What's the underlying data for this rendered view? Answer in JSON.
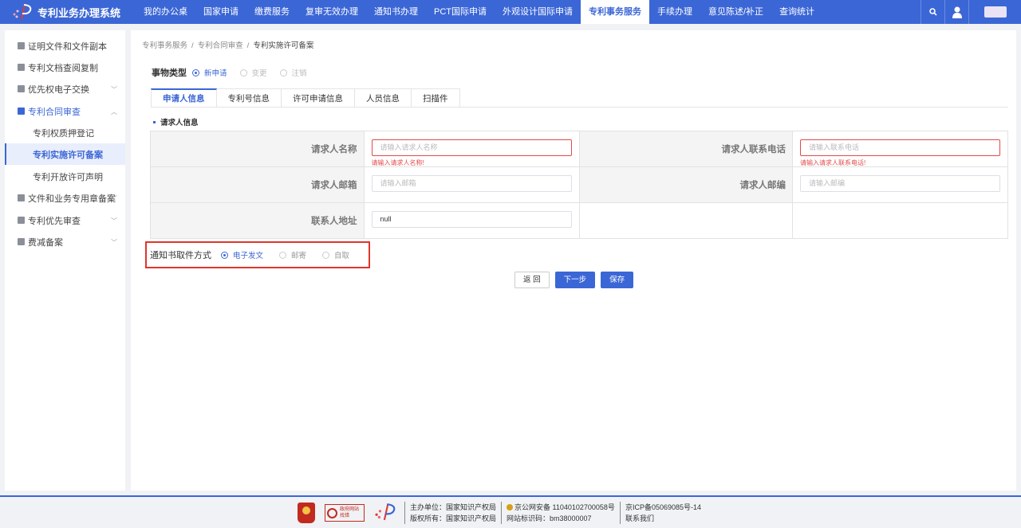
{
  "app": {
    "title": "专利业务办理系统"
  },
  "nav": {
    "items": [
      "我的办公桌",
      "国家申请",
      "缴费服务",
      "复审无效办理",
      "通知书办理",
      "PCT国际申请",
      "外观设计国际申请",
      "专利事务服务",
      "手续办理",
      "意见陈述/补正",
      "查询统计"
    ],
    "active_index": 7
  },
  "sidebar": {
    "items": [
      {
        "label": "证明文件和文件副本",
        "icon": "document-icon"
      },
      {
        "label": "专利文档查阅复制",
        "icon": "file-copy-icon"
      },
      {
        "label": "优先权电子交换",
        "icon": "exchange-icon",
        "chevron": "﹀"
      },
      {
        "label": "专利合同审查",
        "icon": "contract-icon",
        "chevron": "︿"
      },
      {
        "label": "专利权质押登记",
        "sub": true
      },
      {
        "label": "专利实施许可备案",
        "sub": true,
        "active": true
      },
      {
        "label": "专利开放许可声明",
        "sub": true
      },
      {
        "label": "文件和业务专用章备案",
        "icon": "stamp-icon",
        "chevron": "﹀"
      },
      {
        "label": "专利优先审查",
        "icon": "priority-icon",
        "chevron": "﹀"
      },
      {
        "label": "费减备案",
        "icon": "fee-icon",
        "chevron": "﹀"
      }
    ]
  },
  "breadcrumb": {
    "items": [
      "专利事务服务",
      "专利合同审查",
      "专利实施许可备案"
    ],
    "sep": "/"
  },
  "matter_type": {
    "label": "事物类型",
    "options": [
      {
        "label": "新申请",
        "checked": true
      },
      {
        "label": "变更",
        "checked": false
      },
      {
        "label": "注销",
        "checked": false
      }
    ]
  },
  "tabs": [
    "申请人信息",
    "专利号信息",
    "许可申请信息",
    "人员信息",
    "扫描件"
  ],
  "section": {
    "title": "请求人信息"
  },
  "form": {
    "requester_name": {
      "label": "请求人名称",
      "placeholder": "请输入请求人名称",
      "error": "请输入请求人名称!"
    },
    "requester_phone": {
      "label": "请求人联系电话",
      "placeholder": "请输入联系电话",
      "error": "请输入请求人联系电话!"
    },
    "requester_email": {
      "label": "请求人邮箱",
      "placeholder": "请输入邮箱"
    },
    "requester_postcode": {
      "label": "请求人邮编",
      "placeholder": "请输入邮编"
    },
    "contact_address": {
      "label": "联系人地址",
      "value": "null"
    }
  },
  "delivery": {
    "label": "通知书取件方式",
    "options": [
      {
        "label": "电子发文",
        "checked": true
      },
      {
        "label": "邮寄",
        "checked": false
      },
      {
        "label": "自取",
        "checked": false
      }
    ]
  },
  "buttons": {
    "back": "返 回",
    "next": "下一步",
    "save": "保存"
  },
  "footer": {
    "gov_site": "政府网站",
    "gov_site_sub": "找错",
    "host": "主办单位：国家知识产权局",
    "copyright": "版权所有：国家知识产权局",
    "security": "京公网安备 11040102700058号",
    "site_code": "网站标识码：bm38000007",
    "icp": "京ICP备05069085号-14",
    "contact": "联系我们"
  },
  "colors": {
    "primary": "#3b66d6",
    "error": "#e24a4a",
    "highlight_box": "#e0352b"
  }
}
